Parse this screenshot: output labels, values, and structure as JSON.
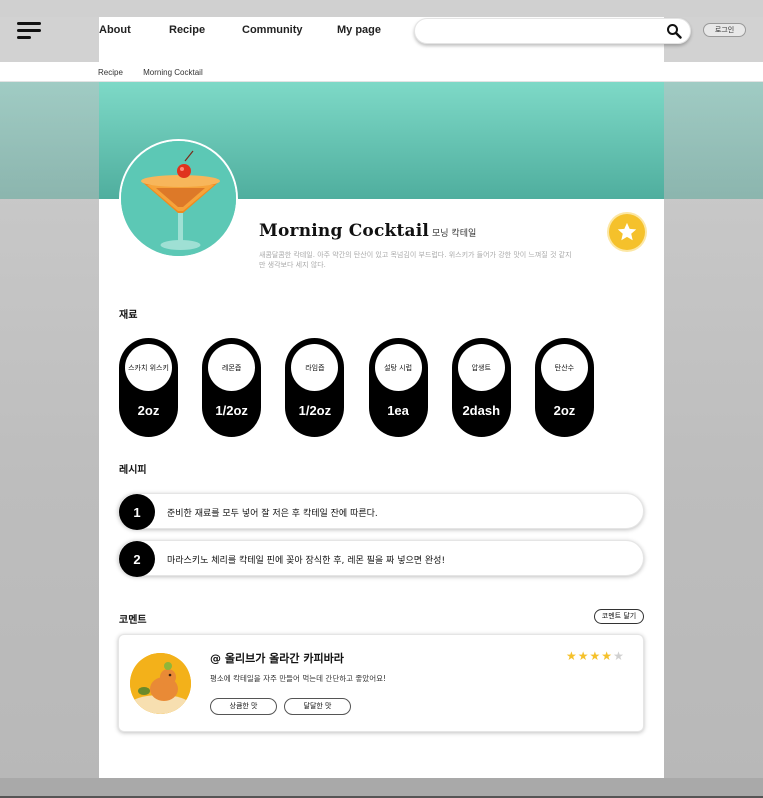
{
  "header": {
    "nav": [
      "About",
      "Recipe",
      "Community",
      "My page"
    ],
    "search_placeholder": "",
    "login_label": "로그인"
  },
  "breadcrumb": [
    "Recipe",
    "Morning Cocktail"
  ],
  "recipe": {
    "title_en": "Morning Cocktail",
    "title_ko": "모닝 칵테일",
    "description": "새콤달콤한 칵테일. 아주 약간의 탄산이 있고 목넘김이 부드럽다. 위스키가 들어가 강한 맛이 느껴질 것 같지만 생각보다 세지 않다."
  },
  "sections": {
    "ingredients": "재료",
    "recipe": "레시피",
    "comments": "코멘트"
  },
  "ingredients": [
    {
      "name": "스카치 위스키",
      "amount": "2oz"
    },
    {
      "name": "레몬즙",
      "amount": "1/2oz"
    },
    {
      "name": "라임즙",
      "amount": "1/2oz"
    },
    {
      "name": "설탕 시럽",
      "amount": "1ea"
    },
    {
      "name": "압생트",
      "amount": "2dash"
    },
    {
      "name": "탄산수",
      "amount": "2oz"
    }
  ],
  "steps": [
    {
      "num": "1",
      "text": "준비한 재료를 모두 넣어 잘 저은 후 칵테일 잔에 따른다."
    },
    {
      "num": "2",
      "text": "마라스키노 체리를 칵테일 핀에 꽂아 장식한 후, 레몬 필을 짜 넣으면 완성!"
    }
  ],
  "comment_button": "코멘트 달기",
  "comment": {
    "user": "@ 올리브가 올라간 카피바라",
    "text": "평소에 칵테일을 자주 만들어 먹는데 간단하고 좋았어요!",
    "tags": [
      "상큼한 맛",
      "달달한 맛"
    ],
    "rating": 4,
    "rating_max": 5
  },
  "colors": {
    "hero_top": "#7ed9c7",
    "hero_bottom": "#4fae9e",
    "star_active": "#f5c12b",
    "star_inactive": "#d0d0d0",
    "pill": "#000000"
  }
}
